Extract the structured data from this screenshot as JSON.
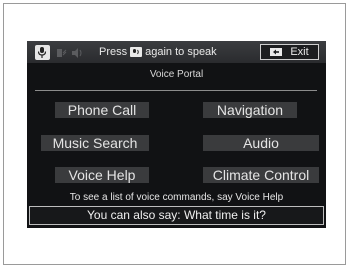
{
  "header": {
    "prompt_before": "Press",
    "prompt_after": "again to speak",
    "exit_label": "Exit"
  },
  "portal": {
    "title": "Voice Portal",
    "commands": [
      "Phone Call",
      "Navigation",
      "Music Search",
      "Audio",
      "Voice Help",
      "Climate Control"
    ]
  },
  "footer": {
    "hint": "To see a list of voice commands, say Voice Help",
    "suggestion": "You can also say: What time is it?"
  },
  "icons": {
    "voice": "microphone-icon",
    "talk_button": "talk-button-icon",
    "back": "back-icon"
  }
}
